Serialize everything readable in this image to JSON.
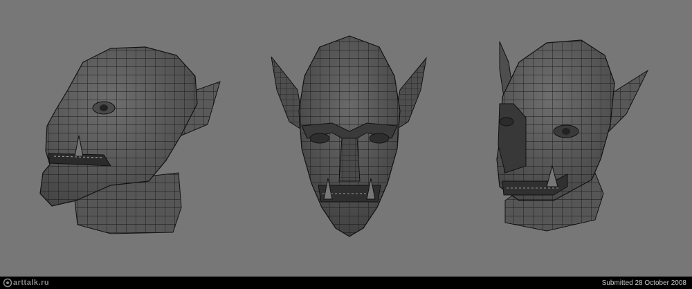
{
  "scene": {
    "background_color": "#777777",
    "mesh_fill": "#5d5d5d",
    "mesh_dark": "#3a3a3a",
    "wire_color": "#111111",
    "views": [
      "left-three-quarter-view",
      "front-view",
      "right-three-quarter-view"
    ]
  },
  "footer": {
    "logo_text": "arttalk.ru",
    "submitted_text": "Submitted 28 October 2008"
  }
}
